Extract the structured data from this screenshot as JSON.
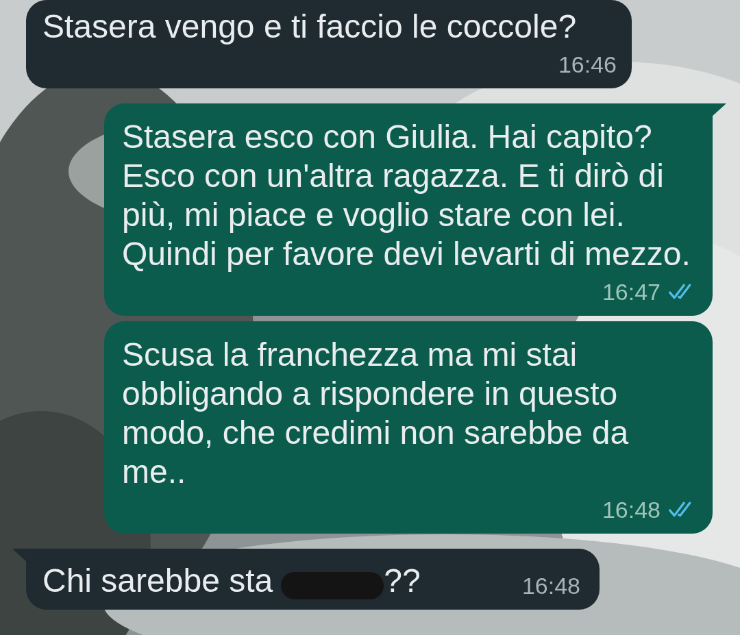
{
  "messages": [
    {
      "kind": "incoming",
      "text": "Stasera vengo e ti faccio le coccole?",
      "time": "16:46",
      "tail": false
    },
    {
      "kind": "outgoing",
      "text": "Stasera esco con Giulia. Hai capito? Esco con un'altra ragazza. E ti dirò di più, mi piace e voglio stare con lei. Quindi per favore devi levarti di mezzo.",
      "time": "16:47",
      "tail": true,
      "read": true
    },
    {
      "kind": "outgoing",
      "text": "Scusa la franchezza ma mi stai obbligando a rispondere in questo modo, che credimi non sarebbe da me..",
      "time": "16:48",
      "tail": false,
      "read": true
    },
    {
      "kind": "incoming",
      "text": "Chi sarebbe sta",
      "text_after": "??",
      "redacted": true,
      "time": "16:48",
      "tail": true
    }
  ]
}
